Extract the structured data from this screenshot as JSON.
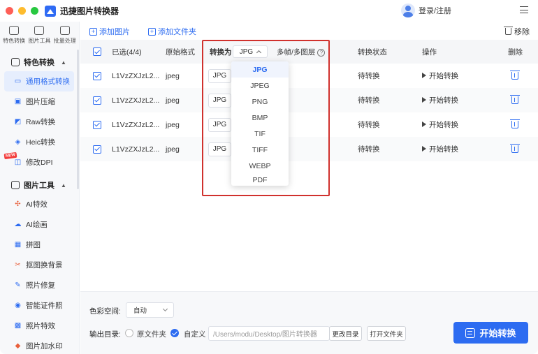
{
  "app": {
    "title": "迅捷图片转换器",
    "login": "登录/注册"
  },
  "sidebar": {
    "top_tools": [
      {
        "label": "特色转换",
        "icon": "convert-icon"
      },
      {
        "label": "图片工具",
        "icon": "image-tool-icon"
      },
      {
        "label": "批量处理",
        "icon": "batch-icon"
      }
    ],
    "sections": [
      {
        "label": "特色转换",
        "items": [
          {
            "label": "通用格式转换",
            "icon": "format-icon",
            "active": true
          },
          {
            "label": "图片压缩",
            "icon": "compress-icon"
          },
          {
            "label": "Raw转换",
            "icon": "raw-icon"
          },
          {
            "label": "Heic转换",
            "icon": "heic-icon"
          },
          {
            "label": "修改DPI",
            "icon": "dpi-icon",
            "badge": "NEW"
          }
        ]
      },
      {
        "label": "图片工具",
        "items": [
          {
            "label": "AI特效",
            "icon": "ai-effect-icon"
          },
          {
            "label": "AI绘画",
            "icon": "ai-paint-icon"
          },
          {
            "label": "拼图",
            "icon": "collage-icon"
          },
          {
            "label": "抠图换背景",
            "icon": "cutout-icon"
          },
          {
            "label": "照片修复",
            "icon": "repair-icon"
          },
          {
            "label": "智能证件照",
            "icon": "id-photo-icon"
          },
          {
            "label": "照片特效",
            "icon": "photo-effect-icon"
          },
          {
            "label": "图片加水印",
            "icon": "watermark-icon"
          }
        ]
      }
    ]
  },
  "toolbar": {
    "add_image": "添加图片",
    "add_folder": "添加文件夹",
    "remove": "移除"
  },
  "table": {
    "headers": {
      "selected": "已选(4/4)",
      "original_format": "原始格式",
      "convert_to": "转换为",
      "convert_to_value": "JPG",
      "multi_frame": "多帧/多图层",
      "status": "转换状态",
      "action": "操作",
      "delete": "删除"
    },
    "rows": [
      {
        "name": "L1VzZXJzL2...",
        "format": "jpeg",
        "target": "JPG",
        "status": "待转换",
        "action": "开始转换"
      },
      {
        "name": "L1VzZXJzL2...",
        "format": "jpeg",
        "target": "JPG",
        "status": "待转换",
        "action": "开始转换"
      },
      {
        "name": "L1VzZXJzL2...",
        "format": "jpeg",
        "target": "JPG",
        "status": "待转换",
        "action": "开始转换"
      },
      {
        "name": "L1VzZXJzL2...",
        "format": "jpeg",
        "target": "JPG",
        "status": "待转换",
        "action": "开始转换"
      }
    ]
  },
  "dropdown": {
    "options": [
      "JPG",
      "JPEG",
      "PNG",
      "BMP",
      "TIF",
      "TIFF",
      "WEBP",
      "PDF"
    ],
    "selected": "JPG"
  },
  "bottom": {
    "color_space_label": "色彩空间:",
    "color_space_value": "自动",
    "output_dir_label": "输出目录:",
    "option_original": "原文件夹",
    "option_custom": "自定义",
    "path": "/Users/modu/Desktop/图片转换器",
    "change_dir": "更改目录",
    "open_folder": "打开文件夹",
    "start": "开始转换"
  },
  "colors": {
    "accent": "#2d6cf1",
    "highlight": "#d0312d",
    "new_badge": "#f23b3b"
  }
}
